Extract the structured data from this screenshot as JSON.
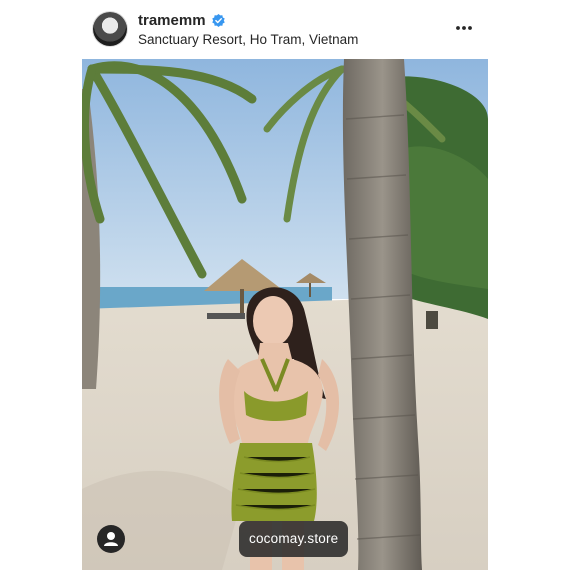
{
  "post": {
    "username": "tramemm",
    "verified": true,
    "location": "Sanctuary Resort, Ho Tram, Vietnam",
    "shop_tag": "cocomay.store"
  },
  "icons": {
    "avatar": "profile-photo",
    "verified": "verified-badge-icon",
    "more": "more-options-icon",
    "user_tag": "user-tag-icon"
  },
  "colors": {
    "verified_blue": "#3897f0",
    "text": "#262626",
    "tag_background": "#262626"
  }
}
